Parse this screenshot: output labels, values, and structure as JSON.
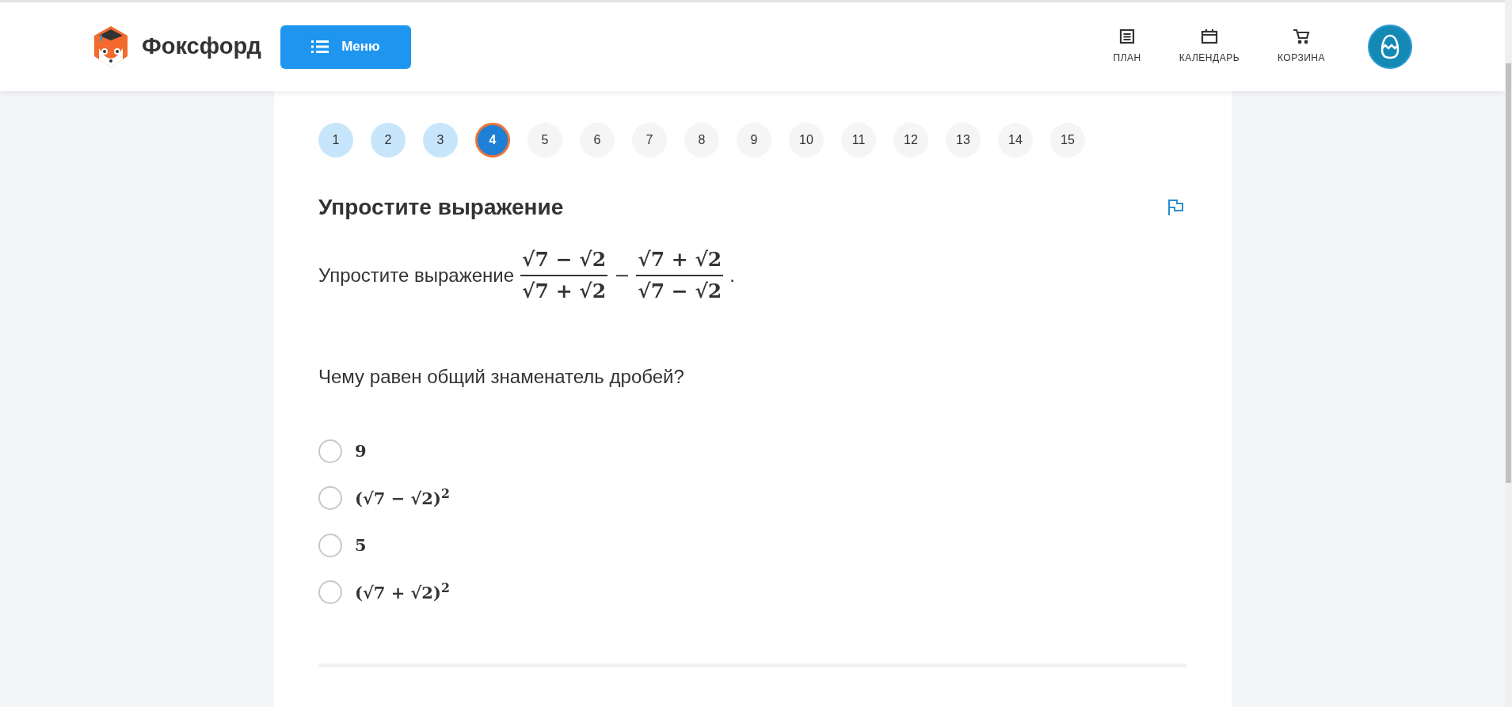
{
  "header": {
    "logo_text": "Фоксфорд",
    "menu_button": "Меню",
    "nav": [
      {
        "kind": "plan",
        "label": "ПЛАН"
      },
      {
        "kind": "calendar",
        "label": "КАЛЕНДАРЬ"
      },
      {
        "kind": "cart",
        "label": "КОРЗИНА"
      }
    ]
  },
  "pagination": [
    {
      "label": "1",
      "answered": true,
      "selected": false
    },
    {
      "label": "2",
      "answered": true,
      "selected": false
    },
    {
      "label": "3",
      "answered": true,
      "selected": false
    },
    {
      "label": "4",
      "selected": true
    },
    {
      "label": "5",
      "answered": false,
      "selected": false
    },
    {
      "label": "6",
      "answered": false,
      "selected": false
    },
    {
      "label": "7",
      "answered": false,
      "selected": false
    },
    {
      "label": "8",
      "answered": false,
      "selected": false
    },
    {
      "label": "9",
      "answered": false,
      "selected": false
    },
    {
      "label": "10",
      "answered": false,
      "selected": false
    },
    {
      "label": "11",
      "answered": false,
      "selected": false
    },
    {
      "label": "12",
      "answered": false,
      "selected": false
    },
    {
      "label": "13",
      "answered": false,
      "selected": false
    },
    {
      "label": "14",
      "answered": false,
      "selected": false
    },
    {
      "label": "15",
      "answered": false,
      "selected": false
    }
  ],
  "task": {
    "title": "Упростите выражение",
    "statement": {
      "text": "Упростите выражение",
      "fractions": [
        {
          "numerator": "√7 − √2",
          "denominator": "√7 + √2"
        },
        {
          "numerator": "√7 + √2",
          "denominator": "√7 − √2"
        }
      ],
      "operator": "−",
      "end": "."
    },
    "question": "Чему равен общий знаменатель дробей?",
    "options": [
      {
        "text": "9",
        "selected": false
      },
      {
        "text": "(√7 − √2)$^{2}$",
        "selected": false
      },
      {
        "text": "5",
        "selected": false
      },
      {
        "text": "(√7 + √2)$^{2}$",
        "selected": false
      }
    ]
  }
}
